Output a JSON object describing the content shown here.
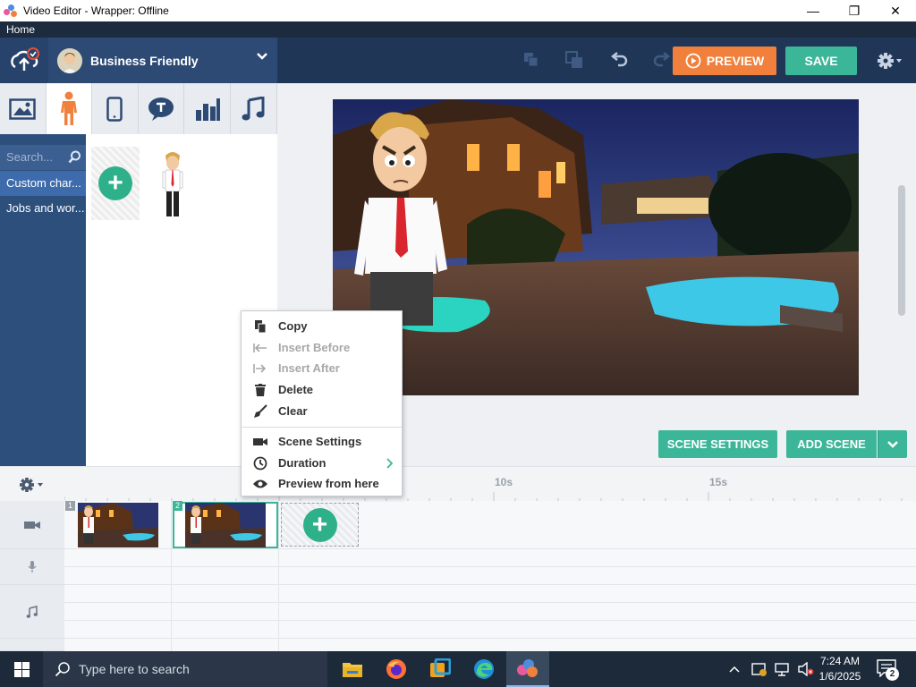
{
  "window": {
    "title": "Video Editor - Wrapper: Offline",
    "minimize_glyph": "—",
    "maximize_glyph": "❐",
    "close_glyph": "✕"
  },
  "menu": {
    "home_label": "Home"
  },
  "toolbar": {
    "theme_name": "Business Friendly",
    "preview_label": "PREVIEW",
    "save_label": "SAVE",
    "colors": {
      "preview": "#f0803c",
      "save": "#3bb699"
    }
  },
  "asset_tabs": [
    {
      "name": "backgrounds",
      "icon": "image-icon",
      "active": false
    },
    {
      "name": "characters",
      "icon": "person-icon",
      "active": true
    },
    {
      "name": "props",
      "icon": "phone-icon",
      "active": false
    },
    {
      "name": "text",
      "icon": "speech-bubble-icon",
      "active": false
    },
    {
      "name": "charts",
      "icon": "bar-chart-icon",
      "active": false
    },
    {
      "name": "music",
      "icon": "music-note-icon",
      "active": false
    }
  ],
  "left_panel": {
    "search_placeholder": "Search...",
    "categories": [
      {
        "label": "Custom char...",
        "active": true
      },
      {
        "label": "Jobs and wor...",
        "active": false
      }
    ]
  },
  "stage_buttons": {
    "scene_settings_label": "SCENE SETTINGS",
    "add_scene_label": "ADD SCENE"
  },
  "context_menu": {
    "items": [
      {
        "label": "Copy",
        "icon": "copy-icon",
        "enabled": true
      },
      {
        "label": "Insert Before",
        "icon": "insert-before-icon",
        "enabled": false
      },
      {
        "label": "Insert After",
        "icon": "insert-after-icon",
        "enabled": false
      },
      {
        "label": "Delete",
        "icon": "trash-icon",
        "enabled": true
      },
      {
        "label": "Clear",
        "icon": "broom-icon",
        "enabled": true
      },
      {
        "label": "Scene Settings",
        "icon": "camera-icon",
        "enabled": true
      },
      {
        "label": "Duration",
        "icon": "clock-icon",
        "enabled": true,
        "submenu": true
      },
      {
        "label": "Preview from here",
        "icon": "eye-icon",
        "enabled": true
      }
    ]
  },
  "timeline": {
    "ruler_labels": [
      "10s",
      "15s"
    ],
    "scenes": [
      {
        "number": "1",
        "selected": false
      },
      {
        "number": "2",
        "selected": true
      }
    ],
    "tracks": [
      "video-camera-icon",
      "microphone-icon",
      "music-note-icon"
    ]
  },
  "taskbar": {
    "search_placeholder": "Type here to search",
    "time": "7:24 AM",
    "date": "1/6/2025",
    "notification_count": "2"
  }
}
